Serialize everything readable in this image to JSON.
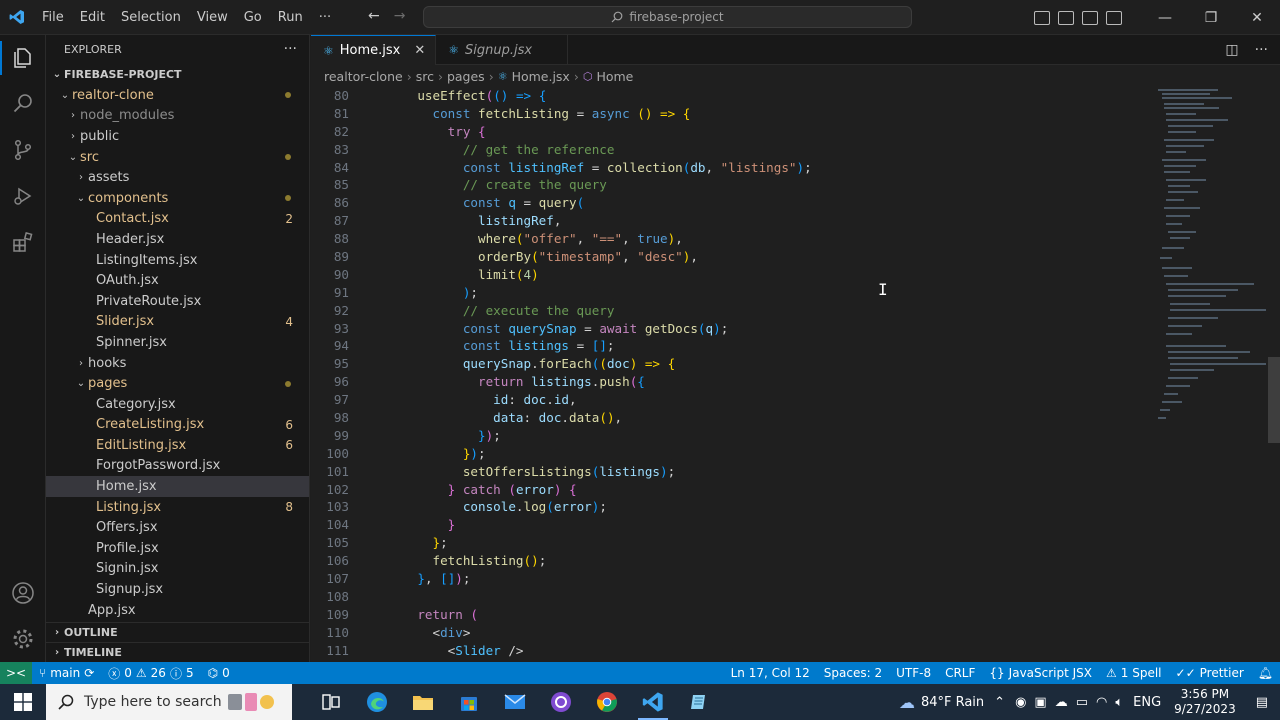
{
  "titlebar": {
    "menu": [
      "File",
      "Edit",
      "Selection",
      "View",
      "Go",
      "Run",
      "···"
    ],
    "command_center": "firebase-project"
  },
  "explorer": {
    "title": "EXPLORER",
    "more": "···",
    "root": "FIREBASE-PROJECT",
    "items": [
      {
        "label": "realtor-clone",
        "depth": 1,
        "type": "folder-open",
        "color": "mod",
        "dot": true
      },
      {
        "label": "node_modules",
        "depth": 2,
        "type": "folder",
        "color": "dim"
      },
      {
        "label": "public",
        "depth": 2,
        "type": "folder",
        "color": "normal"
      },
      {
        "label": "src",
        "depth": 2,
        "type": "folder-open",
        "color": "mod",
        "dot": true
      },
      {
        "label": "assets",
        "depth": 3,
        "type": "folder",
        "color": "normal"
      },
      {
        "label": "components",
        "depth": 3,
        "type": "folder-open",
        "color": "mod",
        "dot": true
      },
      {
        "label": "Contact.jsx",
        "depth": 4,
        "type": "file",
        "color": "mod",
        "badge": "2"
      },
      {
        "label": "Header.jsx",
        "depth": 4,
        "type": "file",
        "color": "normal"
      },
      {
        "label": "ListingItems.jsx",
        "depth": 4,
        "type": "file",
        "color": "normal"
      },
      {
        "label": "OAuth.jsx",
        "depth": 4,
        "type": "file",
        "color": "normal"
      },
      {
        "label": "PrivateRoute.jsx",
        "depth": 4,
        "type": "file",
        "color": "normal"
      },
      {
        "label": "Slider.jsx",
        "depth": 4,
        "type": "file",
        "color": "mod",
        "badge": "4"
      },
      {
        "label": "Spinner.jsx",
        "depth": 4,
        "type": "file",
        "color": "normal"
      },
      {
        "label": "hooks",
        "depth": 3,
        "type": "folder",
        "color": "normal"
      },
      {
        "label": "pages",
        "depth": 3,
        "type": "folder-open",
        "color": "mod",
        "dot": true
      },
      {
        "label": "Category.jsx",
        "depth": 4,
        "type": "file",
        "color": "normal"
      },
      {
        "label": "CreateListing.jsx",
        "depth": 4,
        "type": "file",
        "color": "mod",
        "badge": "6"
      },
      {
        "label": "EditListing.jsx",
        "depth": 4,
        "type": "file",
        "color": "mod",
        "badge": "6"
      },
      {
        "label": "ForgotPassword.jsx",
        "depth": 4,
        "type": "file",
        "color": "normal"
      },
      {
        "label": "Home.jsx",
        "depth": 4,
        "type": "file",
        "color": "normal",
        "selected": true
      },
      {
        "label": "Listing.jsx",
        "depth": 4,
        "type": "file",
        "color": "mod",
        "badge": "8"
      },
      {
        "label": "Offers.jsx",
        "depth": 4,
        "type": "file",
        "color": "normal"
      },
      {
        "label": "Profile.jsx",
        "depth": 4,
        "type": "file",
        "color": "normal"
      },
      {
        "label": "Signin.jsx",
        "depth": 4,
        "type": "file",
        "color": "normal"
      },
      {
        "label": "Signup.jsx",
        "depth": 4,
        "type": "file",
        "color": "normal"
      },
      {
        "label": "App.jsx",
        "depth": 3,
        "type": "file",
        "color": "normal"
      }
    ],
    "outline": "OUTLINE",
    "timeline": "TIMELINE"
  },
  "tabs": [
    {
      "label": "Home.jsx",
      "active": true
    },
    {
      "label": "Signup.jsx",
      "active": false
    }
  ],
  "breadcrumb": [
    "realtor-clone",
    "src",
    "pages",
    "Home.jsx",
    "Home"
  ],
  "code_lines": [
    {
      "n": "80",
      "t": [
        [
          "    ",
          "p"
        ],
        [
          "useEffect",
          "f"
        ],
        [
          "(",
          "b2"
        ],
        [
          "(",
          "b3"
        ],
        [
          ") => ",
          "b3"
        ],
        [
          "{",
          "b3"
        ]
      ]
    },
    {
      "n": "81",
      "t": [
        [
          "      ",
          "p"
        ],
        [
          "const ",
          "k"
        ],
        [
          "fetchListing",
          "f"
        ],
        [
          " = ",
          "p"
        ],
        [
          "async ",
          "k"
        ],
        [
          "() => ",
          "b1"
        ],
        [
          "{",
          "b1"
        ]
      ]
    },
    {
      "n": "82",
      "t": [
        [
          "        ",
          "p"
        ],
        [
          "try ",
          "kc"
        ],
        [
          "{",
          "b2"
        ]
      ]
    },
    {
      "n": "83",
      "t": [
        [
          "          ",
          "p"
        ],
        [
          "// get the reference",
          "c"
        ]
      ]
    },
    {
      "n": "84",
      "t": [
        [
          "          ",
          "p"
        ],
        [
          "const ",
          "k"
        ],
        [
          "listingRef",
          "cn"
        ],
        [
          " = ",
          "p"
        ],
        [
          "collection",
          "f"
        ],
        [
          "(",
          "b3"
        ],
        [
          "db",
          "v"
        ],
        [
          ", ",
          "p"
        ],
        [
          "\"listings\"",
          "s"
        ],
        [
          ")",
          "b3"
        ],
        [
          ";",
          "p"
        ]
      ]
    },
    {
      "n": "85",
      "t": [
        [
          "          ",
          "p"
        ],
        [
          "// create the query",
          "c"
        ]
      ]
    },
    {
      "n": "86",
      "t": [
        [
          "          ",
          "p"
        ],
        [
          "const ",
          "k"
        ],
        [
          "q",
          "cn"
        ],
        [
          " = ",
          "p"
        ],
        [
          "query",
          "f"
        ],
        [
          "(",
          "b3"
        ]
      ]
    },
    {
      "n": "87",
      "t": [
        [
          "            ",
          "p"
        ],
        [
          "listingRef",
          "v"
        ],
        [
          ",",
          "p"
        ]
      ]
    },
    {
      "n": "88",
      "t": [
        [
          "            ",
          "p"
        ],
        [
          "where",
          "f"
        ],
        [
          "(",
          "b1"
        ],
        [
          "\"offer\"",
          "s"
        ],
        [
          ", ",
          "p"
        ],
        [
          "\"==\"",
          "s"
        ],
        [
          ", ",
          "p"
        ],
        [
          "true",
          "k"
        ],
        [
          ")",
          "b1"
        ],
        [
          ",",
          "p"
        ]
      ]
    },
    {
      "n": "89",
      "t": [
        [
          "            ",
          "p"
        ],
        [
          "orderBy",
          "f"
        ],
        [
          "(",
          "b1"
        ],
        [
          "\"timestamp\"",
          "s"
        ],
        [
          ", ",
          "p"
        ],
        [
          "\"desc\"",
          "s"
        ],
        [
          ")",
          "b1"
        ],
        [
          ",",
          "p"
        ]
      ]
    },
    {
      "n": "90",
      "t": [
        [
          "            ",
          "p"
        ],
        [
          "limit",
          "f"
        ],
        [
          "(",
          "b1"
        ],
        [
          "4",
          "n"
        ],
        [
          ")",
          "b1"
        ]
      ]
    },
    {
      "n": "91",
      "t": [
        [
          "          ",
          "p"
        ],
        [
          ")",
          "b3"
        ],
        [
          ";",
          "p"
        ]
      ]
    },
    {
      "n": "92",
      "t": [
        [
          "          ",
          "p"
        ],
        [
          "// execute the query",
          "c"
        ]
      ]
    },
    {
      "n": "93",
      "t": [
        [
          "          ",
          "p"
        ],
        [
          "const ",
          "k"
        ],
        [
          "querySnap",
          "cn"
        ],
        [
          " = ",
          "p"
        ],
        [
          "await ",
          "kc"
        ],
        [
          "getDocs",
          "f"
        ],
        [
          "(",
          "b3"
        ],
        [
          "q",
          "v"
        ],
        [
          ")",
          "b3"
        ],
        [
          ";",
          "p"
        ]
      ]
    },
    {
      "n": "94",
      "t": [
        [
          "          ",
          "p"
        ],
        [
          "const ",
          "k"
        ],
        [
          "listings",
          "cn"
        ],
        [
          " = ",
          "p"
        ],
        [
          "[]",
          "b3"
        ],
        [
          ";",
          "p"
        ]
      ]
    },
    {
      "n": "95",
      "t": [
        [
          "          ",
          "p"
        ],
        [
          "querySnap",
          "v"
        ],
        [
          ".",
          "p"
        ],
        [
          "forEach",
          "f"
        ],
        [
          "(",
          "b3"
        ],
        [
          "(",
          "b1"
        ],
        [
          "doc",
          "v"
        ],
        [
          ") => ",
          "b1"
        ],
        [
          "{",
          "b1"
        ]
      ]
    },
    {
      "n": "96",
      "t": [
        [
          "            ",
          "p"
        ],
        [
          "return ",
          "kc"
        ],
        [
          "listings",
          "v"
        ],
        [
          ".",
          "p"
        ],
        [
          "push",
          "f"
        ],
        [
          "(",
          "b2"
        ],
        [
          "{",
          "b3"
        ]
      ]
    },
    {
      "n": "97",
      "t": [
        [
          "              ",
          "p"
        ],
        [
          "id",
          "v"
        ],
        [
          ": ",
          "p"
        ],
        [
          "doc",
          "v"
        ],
        [
          ".",
          "p"
        ],
        [
          "id",
          "v"
        ],
        [
          ",",
          "p"
        ]
      ]
    },
    {
      "n": "98",
      "t": [
        [
          "              ",
          "p"
        ],
        [
          "data",
          "v"
        ],
        [
          ": ",
          "p"
        ],
        [
          "doc",
          "v"
        ],
        [
          ".",
          "p"
        ],
        [
          "data",
          "f"
        ],
        [
          "(",
          "b1"
        ],
        [
          ")",
          "b1"
        ],
        [
          ",",
          "p"
        ]
      ]
    },
    {
      "n": "99",
      "t": [
        [
          "            ",
          "p"
        ],
        [
          "}",
          "b3"
        ],
        [
          ")",
          "b2"
        ],
        [
          ";",
          "p"
        ]
      ]
    },
    {
      "n": "100",
      "t": [
        [
          "          ",
          "p"
        ],
        [
          "}",
          "b1"
        ],
        [
          ")",
          "b3"
        ],
        [
          ";",
          "p"
        ]
      ]
    },
    {
      "n": "101",
      "t": [
        [
          "          ",
          "p"
        ],
        [
          "setOffersListings",
          "f"
        ],
        [
          "(",
          "b3"
        ],
        [
          "listings",
          "v"
        ],
        [
          ")",
          "b3"
        ],
        [
          ";",
          "p"
        ]
      ]
    },
    {
      "n": "102",
      "t": [
        [
          "        ",
          "p"
        ],
        [
          "} ",
          "b2"
        ],
        [
          "catch ",
          "kc"
        ],
        [
          "(",
          "b2"
        ],
        [
          "error",
          "v"
        ],
        [
          ") ",
          "b2"
        ],
        [
          "{",
          "b2"
        ]
      ]
    },
    {
      "n": "103",
      "t": [
        [
          "          ",
          "p"
        ],
        [
          "console",
          "v"
        ],
        [
          ".",
          "p"
        ],
        [
          "log",
          "f"
        ],
        [
          "(",
          "b3"
        ],
        [
          "error",
          "v"
        ],
        [
          ")",
          "b3"
        ],
        [
          ";",
          "p"
        ]
      ]
    },
    {
      "n": "104",
      "t": [
        [
          "        ",
          "p"
        ],
        [
          "}",
          "b2"
        ]
      ]
    },
    {
      "n": "105",
      "t": [
        [
          "      ",
          "p"
        ],
        [
          "}",
          "b1"
        ],
        [
          ";",
          "p"
        ]
      ]
    },
    {
      "n": "106",
      "t": [
        [
          "      ",
          "p"
        ],
        [
          "fetchListing",
          "f"
        ],
        [
          "(",
          "b1"
        ],
        [
          ")",
          "b1"
        ],
        [
          ";",
          "p"
        ]
      ]
    },
    {
      "n": "107",
      "t": [
        [
          "    ",
          "p"
        ],
        [
          "}",
          "b3"
        ],
        [
          ", ",
          "p"
        ],
        [
          "[]",
          "b3"
        ],
        [
          ")",
          "b2"
        ],
        [
          ";",
          "p"
        ]
      ]
    },
    {
      "n": "108",
      "t": []
    },
    {
      "n": "109",
      "t": [
        [
          "    ",
          "p"
        ],
        [
          "return ",
          "kc"
        ],
        [
          "(",
          "b2"
        ]
      ]
    },
    {
      "n": "110",
      "t": [
        [
          "      ",
          "p"
        ],
        [
          "<",
          "p"
        ],
        [
          "div",
          "k"
        ],
        [
          ">",
          "p"
        ]
      ]
    },
    {
      "n": "111",
      "t": [
        [
          "        ",
          "p"
        ],
        [
          "<",
          "p"
        ],
        [
          "Slider",
          "cn"
        ],
        [
          " />",
          "p"
        ]
      ]
    }
  ],
  "statusbar": {
    "branch": "main",
    "errors": "0",
    "warnings": "26",
    "infos": "5",
    "ports": "0",
    "position": "Ln 17, Col 12",
    "spaces": "Spaces: 2",
    "encoding": "UTF-8",
    "eol": "CRLF",
    "language": "JavaScript JSX",
    "spell": "1 Spell",
    "prettier": "Prettier"
  },
  "taskbar": {
    "search_placeholder": "Type here to search",
    "weather": "84°F  Rain",
    "language": "ENG",
    "time": "3:56 PM",
    "date": "9/27/2023"
  },
  "colors": {
    "accent": "#007acc",
    "modified": "#e2c08d"
  }
}
